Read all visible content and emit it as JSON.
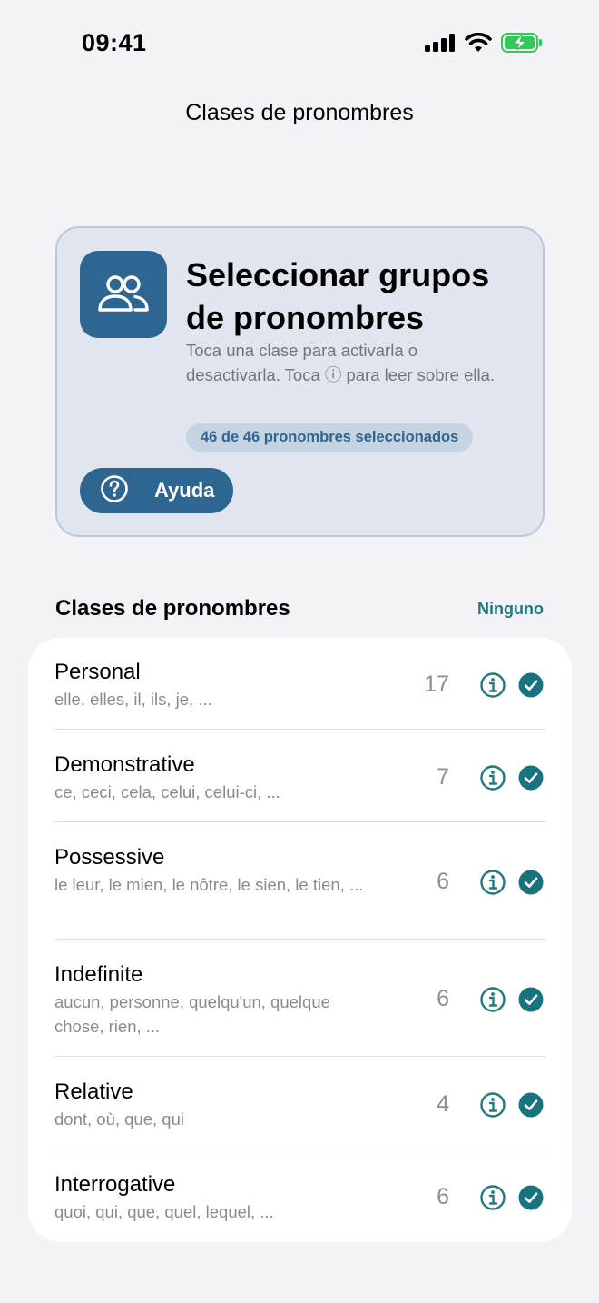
{
  "status_bar": {
    "time": "09:41",
    "icons": [
      "signal-icon",
      "wifi-icon",
      "battery-charging-icon"
    ],
    "battery_color": "#34c759"
  },
  "nav": {
    "title": "Clases de pronombres"
  },
  "header": {
    "icon": "people-icon",
    "title": "Seleccionar grupos de pronombres",
    "description": "Toca una clase para activarla o desactivarla. Toca ⓘ para leer sobre ella.",
    "badge": "46 de 46 pronombres seleccionados",
    "help_label": "Ayuda",
    "help_icon": "question-circle-icon",
    "accent_color": "#2e6591"
  },
  "section": {
    "title": "Clases de pronombres",
    "action": "Ninguno",
    "action_color": "#1e7a82"
  },
  "rows": [
    {
      "name": "Personal",
      "examples": "elle, elles, il, ils, je, ...",
      "count": "17",
      "selected": true
    },
    {
      "name": "Demonstrative",
      "examples": "ce, ceci, cela, celui, celui-ci, ...",
      "count": "7",
      "selected": true
    },
    {
      "name": "Possessive",
      "examples": "le leur, le mien, le nôtre, le sien, le tien, ...",
      "count": "6",
      "selected": true
    },
    {
      "name": "Indefinite",
      "examples": "aucun, personne, quelqu'un, quelque chose, rien, ...",
      "count": "6",
      "selected": true
    },
    {
      "name": "Relative",
      "examples": "dont, où, que, qui",
      "count": "4",
      "selected": true
    },
    {
      "name": "Interrogative",
      "examples": "quoi, qui, que, quel, lequel, ...",
      "count": "6",
      "selected": true
    }
  ]
}
